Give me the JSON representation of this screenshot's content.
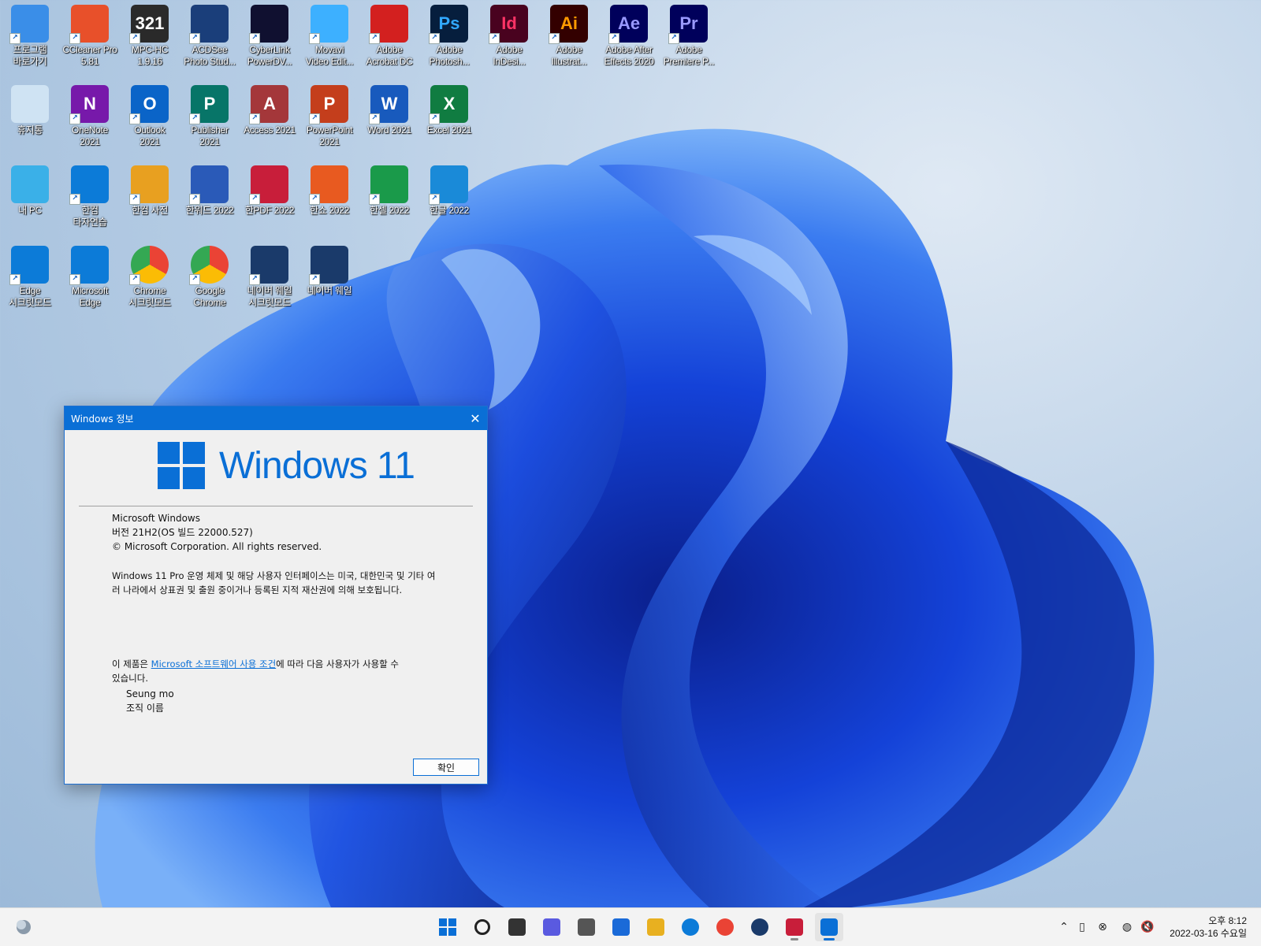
{
  "desktop": {
    "icons": [
      {
        "label": "프로그램\n바로가기",
        "icon": "tv-icon",
        "bg": "#3a8ee8"
      },
      {
        "label": "CCleaner Pro\n5.81",
        "icon": "ccleaner-icon",
        "bg": "#e8502a"
      },
      {
        "label": "MPC-HC\n1.9.16",
        "icon": "mpc-hc-icon",
        "bg": "#2a2a2a",
        "text": "321"
      },
      {
        "label": "ACDSee\nPhoto Stud...",
        "icon": "acdsee-icon",
        "bg": "#1a3e7a"
      },
      {
        "label": "CyberLink\nPowerDV...",
        "icon": "powerdvd-icon",
        "bg": "#101030"
      },
      {
        "label": "Movavi\nVideo Edit...",
        "icon": "movavi-icon",
        "bg": "#3db0ff"
      },
      {
        "label": "Adobe\nAcrobat DC",
        "icon": "acrobat-icon",
        "bg": "#d3201f"
      },
      {
        "label": "Adobe\nPhotosh...",
        "icon": "photoshop-icon",
        "bg": "#061e3d",
        "text": "Ps",
        "fg": "#31a8ff"
      },
      {
        "label": "Adobe\nInDesi...",
        "icon": "indesign-icon",
        "bg": "#49021f",
        "text": "Id",
        "fg": "#ff3366"
      },
      {
        "label": "Adobe\nIllustrat...",
        "icon": "illustrator-icon",
        "bg": "#330000",
        "text": "Ai",
        "fg": "#ff9a00"
      },
      {
        "label": "Adobe After\nEffects 2020",
        "icon": "after-effects-icon",
        "bg": "#00005b",
        "text": "Ae",
        "fg": "#9999ff"
      },
      {
        "label": "Adobe\nPremiere P...",
        "icon": "premiere-icon",
        "bg": "#00005b",
        "text": "Pr",
        "fg": "#9999ff"
      },
      {
        "label": "휴지통",
        "icon": "recycle-bin-icon",
        "bg": "#cfe3f3"
      },
      {
        "label": "OneNote\n2021",
        "icon": "onenote-icon",
        "bg": "#7719aa",
        "text": "N"
      },
      {
        "label": "Outlook\n2021",
        "icon": "outlook-icon",
        "bg": "#0a64c8",
        "text": "O"
      },
      {
        "label": "Publisher\n2021",
        "icon": "publisher-icon",
        "bg": "#077568",
        "text": "P"
      },
      {
        "label": "Access 2021",
        "icon": "access-icon",
        "bg": "#a4373a",
        "text": "A"
      },
      {
        "label": "PowerPoint\n2021",
        "icon": "powerpoint-icon",
        "bg": "#c43e1c",
        "text": "P"
      },
      {
        "label": "Word 2021",
        "icon": "word-icon",
        "bg": "#185abd",
        "text": "W"
      },
      {
        "label": "Excel 2021",
        "icon": "excel-icon",
        "bg": "#107c41",
        "text": "X"
      },
      {
        "label": "내 PC",
        "icon": "monitor-icon",
        "bg": "#3ab0e8"
      },
      {
        "label": "한컴\n타자연습",
        "icon": "edge-icon",
        "bg": "#0c7bd8"
      },
      {
        "label": "한컴 사전",
        "icon": "hancom-dictionary-icon",
        "bg": "#e8a020"
      },
      {
        "label": "한워드 2022",
        "icon": "hanword-icon",
        "bg": "#2a5ab8"
      },
      {
        "label": "한PDF 2022",
        "icon": "hanpdf-icon",
        "bg": "#c81e3a"
      },
      {
        "label": "한쇼 2022",
        "icon": "hanshow-icon",
        "bg": "#e85a20"
      },
      {
        "label": "한셀 2022",
        "icon": "hancell-icon",
        "bg": "#1a9a4a"
      },
      {
        "label": "한글 2022",
        "icon": "hangul-icon",
        "bg": "#1a8ad8"
      },
      {
        "label": "Edge\n시크릿모드",
        "icon": "edge-icon",
        "bg": "#0c7bd8"
      },
      {
        "label": "Microsoft\nEdge",
        "icon": "edge-icon",
        "bg": "#0c7bd8"
      },
      {
        "label": "Chrome\n시크릿모드",
        "icon": "chrome-icon",
        "bg": "#ffffff"
      },
      {
        "label": "Google\nChrome",
        "icon": "chrome-icon",
        "bg": "#ffffff"
      },
      {
        "label": "네이버 웨일\n시크릿모드",
        "icon": "whale-icon",
        "bg": "#1a3a6a"
      },
      {
        "label": "네이버 웨일",
        "icon": "whale-icon",
        "bg": "#1a3a6a"
      }
    ]
  },
  "dialog": {
    "title": "Windows 정보",
    "logo_text": "Windows 11",
    "product": "Microsoft Windows",
    "version": "버전 21H2(OS 빌드 22000.527)",
    "copyright": "© Microsoft Corporation. All rights reserved.",
    "legal": "Windows 11 Pro 운영 체제 및 해당 사용자 인터페이스는 미국, 대한민국 및 기타 여러 나라에서 상표권 및 출원 중이거나 등록된 지적 재산권에 의해 보호됩니다.",
    "license_prefix": "이 제품은 ",
    "license_link": "Microsoft 소프트웨어 사용 조건",
    "license_suffix": "에 따라 다음 사용자가 사용할 수 있습니다.",
    "user_name": "Seung mo",
    "org_name": "조직 이름",
    "ok_label": "확인",
    "accent": "#0a6fd6"
  },
  "taskbar": {
    "items": [
      {
        "name": "start-button",
        "icon": "windows-logo-icon"
      },
      {
        "name": "search-button",
        "icon": "search-icon"
      },
      {
        "name": "task-view-button",
        "icon": "task-view-icon"
      },
      {
        "name": "chat-button",
        "icon": "chat-icon"
      },
      {
        "name": "settings-button",
        "icon": "gear-icon"
      },
      {
        "name": "store-button",
        "icon": "store-icon"
      },
      {
        "name": "file-explorer-button",
        "icon": "folder-icon"
      },
      {
        "name": "edge-button",
        "icon": "edge-icon"
      },
      {
        "name": "chrome-button",
        "icon": "chrome-icon"
      },
      {
        "name": "whale-button",
        "icon": "whale-icon"
      },
      {
        "name": "app-button",
        "icon": "app-icon"
      },
      {
        "name": "winver-button",
        "icon": "window-icon"
      }
    ],
    "clock_time": "오후 8:12",
    "clock_date": "2022-03-16 수요일"
  }
}
